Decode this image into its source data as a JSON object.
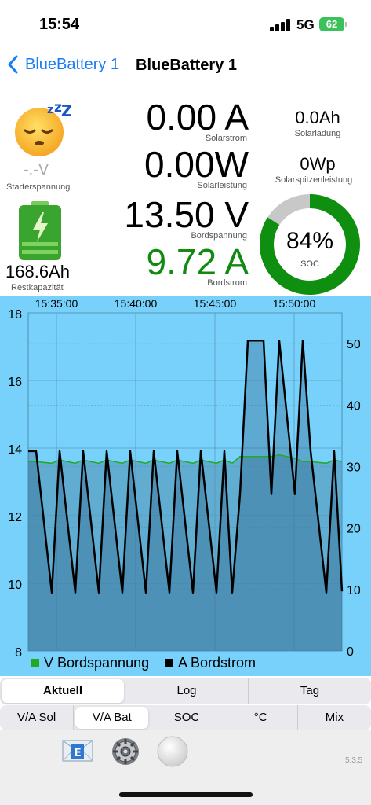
{
  "status": {
    "time": "15:54",
    "network": "5G",
    "battery": "62"
  },
  "nav": {
    "back_label": "BlueBattery 1",
    "title": "BlueBattery 1"
  },
  "left": {
    "starter_value": "-.-V",
    "starter_label": "Starterspannung",
    "capacity_value": "168.6Ah",
    "capacity_label": "Restkapazität"
  },
  "center": {
    "solar_current": "0.00 A",
    "solar_current_label": "Solarstrom",
    "solar_power": "0.00W",
    "solar_power_label": "Solarleistung",
    "board_voltage": "13.50 V",
    "board_voltage_label": "Bordspannung",
    "board_current": "9.72 A",
    "board_current_label": "Bordstrom"
  },
  "right": {
    "solar_charge": "0.0Ah",
    "solar_charge_label": "Solarladung",
    "solar_peak": "0Wp",
    "solar_peak_label": "Solarspitzenleistung",
    "soc_value": "84%",
    "soc_label": "SOC"
  },
  "colors": {
    "accent": "#1a7cf5",
    "green": "#128a12",
    "chart_bg": "#78d1fb",
    "soc_ring": "#0f8f0f",
    "soc_track": "#c8c8c8"
  },
  "soc_fraction": 0.84,
  "chart_data": {
    "type": "line",
    "x_ticks": [
      "15:35:00",
      "15:40:00",
      "15:45:00",
      "15:50:00"
    ],
    "y_left_ticks": [
      "8",
      "10",
      "12",
      "14",
      "16",
      "18"
    ],
    "y_right_ticks": [
      "0",
      "10",
      "20",
      "30",
      "40",
      "50"
    ],
    "ylim_left": [
      8,
      18
    ],
    "ylim_right": [
      0,
      55
    ],
    "grid": true,
    "legend_placement": "bottom-left",
    "x_minutes": [
      0,
      0.5,
      1.5,
      2,
      3,
      3.5,
      4.5,
      5,
      6,
      6.5,
      7.5,
      8,
      9,
      9.5,
      10.5,
      11,
      12,
      12.5,
      13,
      13.5,
      14,
      15,
      15.5,
      16,
      17,
      17.5,
      18,
      19,
      19.5,
      20
    ],
    "series": [
      {
        "name": "V Bordspannung",
        "color": "#22aa22",
        "values": [
          13.6,
          13.6,
          13.55,
          13.65,
          13.55,
          13.65,
          13.55,
          13.65,
          13.55,
          13.65,
          13.55,
          13.65,
          13.55,
          13.65,
          13.55,
          13.65,
          13.55,
          13.65,
          13.55,
          13.75,
          13.75,
          13.75,
          13.75,
          13.8,
          13.7,
          13.6,
          13.6,
          13.55,
          13.65,
          13.6
        ]
      },
      {
        "name": "A Bordstrom",
        "color": "#000000",
        "values": [
          32.5,
          32.5,
          9.5,
          32.5,
          9.5,
          32.5,
          9.5,
          32.5,
          9.5,
          32.5,
          9.5,
          32.5,
          9.5,
          32.5,
          9.5,
          32.5,
          9.5,
          32.5,
          9.5,
          25.5,
          50.5,
          50.5,
          25.5,
          50.5,
          25.5,
          50.5,
          32.5,
          9.5,
          32.5,
          9.7
        ]
      }
    ]
  },
  "tabs_top": [
    "Aktuell",
    "Log",
    "Tag"
  ],
  "tabs_bottom": [
    "V/A Sol",
    "V/A Bat",
    "SOC",
    "°C",
    "Mix"
  ],
  "footer": {
    "version": "5.3.5",
    "mail_letter": "E"
  }
}
